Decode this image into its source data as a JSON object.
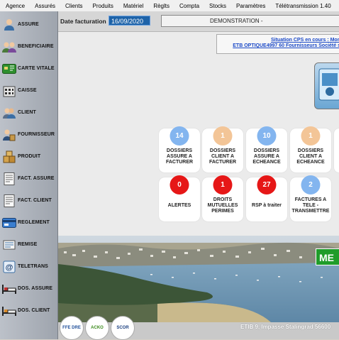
{
  "menu": [
    "Agence",
    "Assurés",
    "Clients",
    "Produits",
    "Matériel",
    "Règlts",
    "Compta",
    "Stocks",
    "Paramètres",
    "Télétransmission 1.40"
  ],
  "sidebar": [
    {
      "label": "ASSURE",
      "icon": "person-icon"
    },
    {
      "label": "BENEFICIAIRE",
      "icon": "people-icon"
    },
    {
      "label": "CARTE VITALE",
      "icon": "vitale-card-icon"
    },
    {
      "label": "CAISSE",
      "icon": "building-icon"
    },
    {
      "label": "CLIENT",
      "icon": "people-icon"
    },
    {
      "label": "FOURNISSEUR",
      "icon": "supplier-icon"
    },
    {
      "label": "PRODUIT",
      "icon": "boxes-icon"
    },
    {
      "label": "FACT. ASSURE",
      "icon": "invoice-icon"
    },
    {
      "label": "FACT. CLIENT",
      "icon": "invoice-icon"
    },
    {
      "label": "REGLEMENT",
      "icon": "payment-card-icon"
    },
    {
      "label": "REMISE",
      "icon": "remittance-icon"
    },
    {
      "label": "TELETRANS",
      "icon": "at-sign-icon"
    },
    {
      "label": "DOS. ASSURE",
      "icon": "bed-icon"
    },
    {
      "label": "DOS. CLIENT",
      "icon": "bed-icon"
    }
  ],
  "header": {
    "date_label": "Date facturation",
    "date_value": "16/09/2020",
    "demo_text": "DEMONSTRATION - "
  },
  "info": {
    "line1": "Situation CPS en cours : Mon",
    "line2": "ETB OPTIQUE4997 60 Fournisseurs Société s"
  },
  "tiles_row1": [
    {
      "count": "14",
      "label": "DOSSIERS ASSURE A FACTURER",
      "color": "blue"
    },
    {
      "count": "1",
      "label": "DOSSIERS CLIENT A FACTURER",
      "color": "orange"
    },
    {
      "count": "10",
      "label": "DOSSIERS ASSURE A ECHEANCE",
      "color": "blue"
    },
    {
      "count": "1",
      "label": "DOSSIERS CLIENT A ECHEANCE",
      "color": "orange"
    }
  ],
  "tiles_row2": [
    {
      "count": "0",
      "label": "ALERTES",
      "color": "red"
    },
    {
      "count": "1",
      "label": "DROITS MUTUELLES PERIMES",
      "color": "red"
    },
    {
      "count": "27",
      "label": "RSP à traiter",
      "color": "red"
    },
    {
      "count": "2",
      "label": "FACTURES A TELE - TRANSMETTRE",
      "color": "blue"
    }
  ],
  "banner": {
    "tag": "ME"
  },
  "footer": {
    "address": "ETIB 9, Impasse Stalingrad  56600",
    "logos": [
      "FFE DRE",
      "ACKO",
      "SCOR"
    ]
  },
  "colors": {
    "blue": "#83b5ef",
    "orange": "#f3c597",
    "red": "#e61717",
    "date_bg": "#1e63a8"
  }
}
